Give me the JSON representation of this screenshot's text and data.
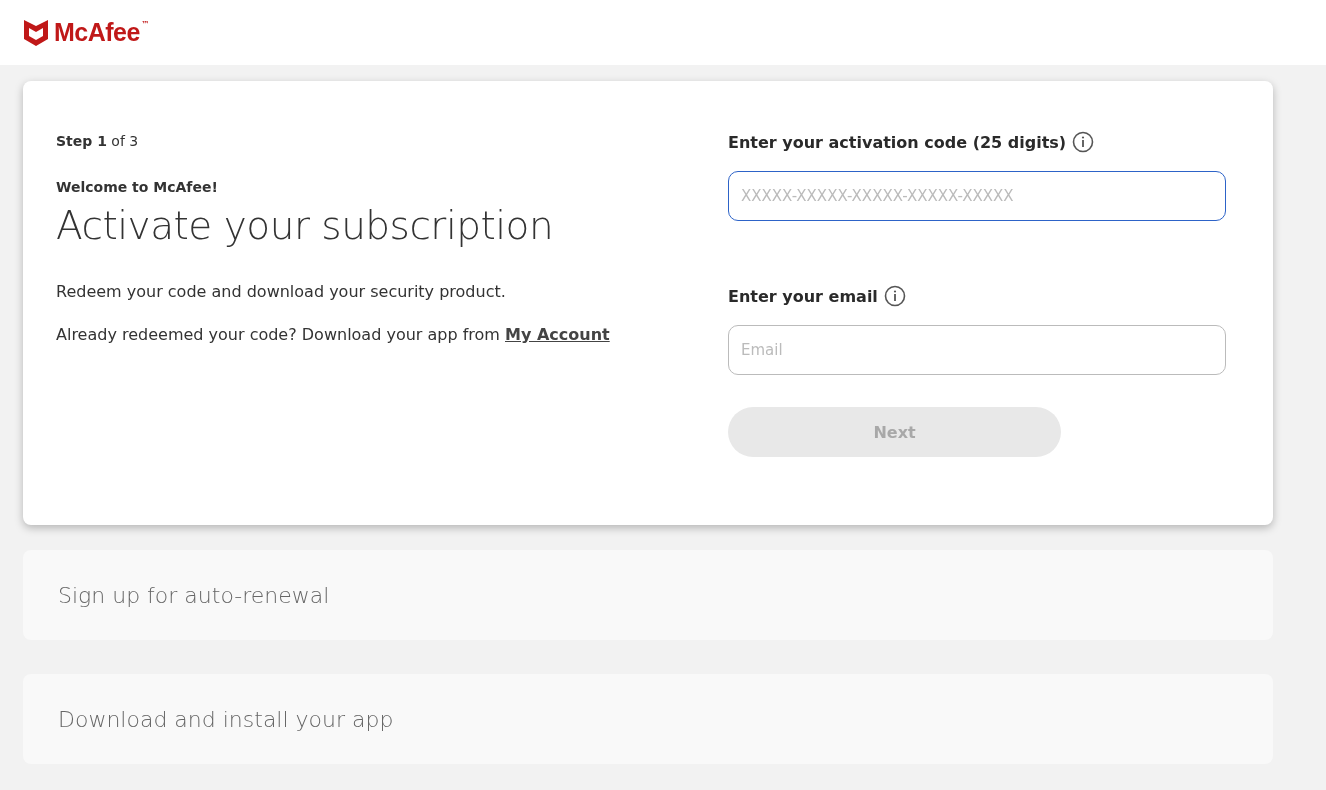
{
  "header": {
    "logo": {
      "name": "McAfee",
      "trademark": "™"
    }
  },
  "activation": {
    "step": "**Step 1** of 3",
    "welcome": "Welcome to McAfee!",
    "title": "Activate your subscription",
    "description": "Redeem your code and download your security product.",
    "account_note": {
      "text": "Already redeemed your code? Download your app from ",
      "link": "My Account"
    },
    "fields": [
      {
        "label": "Enter your activation code (25 digits)",
        "placeholder": "XXXXX-XXXXX-XXXXX-XXXXX-XXXXX",
        "focused": true
      },
      {
        "label": "Enter your email",
        "placeholder": "Email",
        "focused": false
      }
    ],
    "next_button": {
      "label": "Next",
      "disabled": true
    }
  },
  "steps": [
    {
      "title": "Sign up for auto-renewal"
    },
    {
      "title": "Download and install your app"
    }
  ]
}
